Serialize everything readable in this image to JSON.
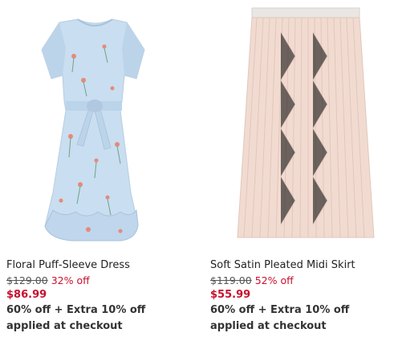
{
  "products": [
    {
      "name": "Floral Puff-Sleeve Dress",
      "original_price": "$129.00",
      "discount": "32% off",
      "sale_price": "$86.99",
      "promo": "60% off + Extra 10% off applied at checkout",
      "image_icon": "floral-dress-image"
    },
    {
      "name": "Soft Satin Pleated Midi Skirt",
      "original_price": "$119.00",
      "discount": "52% off",
      "sale_price": "$55.99",
      "promo": "60% off + Extra 10% off applied at checkout",
      "image_icon": "pleated-skirt-image"
    }
  ],
  "colors": {
    "sale": "#c8102e",
    "dress": "#c7dcef",
    "skirt": "#efd6cc"
  }
}
